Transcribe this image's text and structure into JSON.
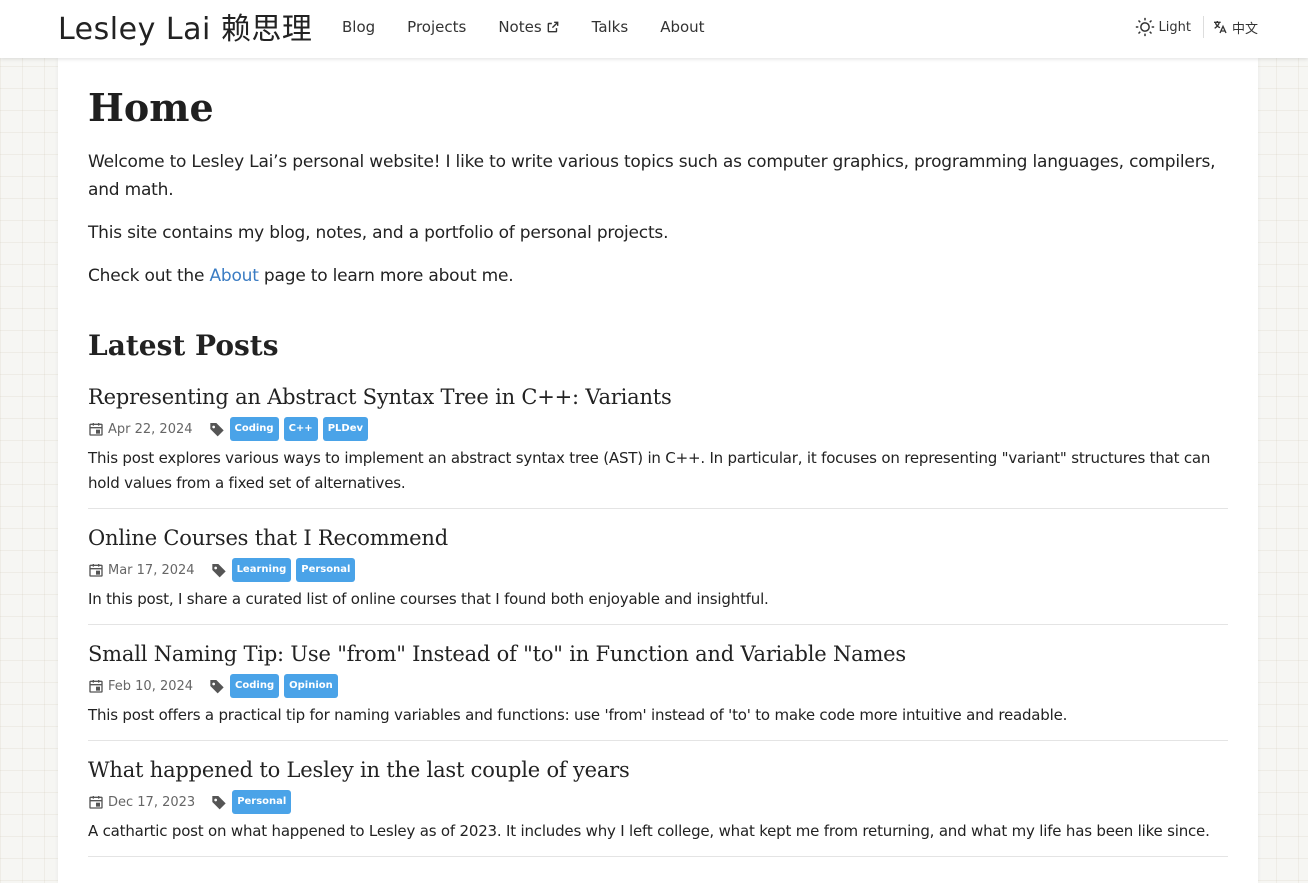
{
  "site": {
    "brand": "Lesley Lai 赖思理"
  },
  "nav": {
    "links": [
      {
        "label": "Blog"
      },
      {
        "label": "Projects"
      },
      {
        "label": "Notes",
        "icon": "external-link-icon"
      },
      {
        "label": "Talks"
      },
      {
        "label": "About"
      }
    ],
    "theme_label": "Light",
    "theme_icon": "sun-icon",
    "lang_label": "中文",
    "lang_icon": "translate-icon"
  },
  "home": {
    "title": "Home",
    "intro": {
      "p1": "Welcome to Lesley Lai’s personal website! I like to write various topics such as computer graphics, programming languages, compilers, and math.",
      "p2": "This site contains my blog, notes, and a portfolio of personal projects.",
      "p3_before": "Check out the ",
      "p3_link": "About",
      "p3_after": " page to learn more about me."
    },
    "latest_title": "Latest Posts",
    "posts": [
      {
        "title": "Representing an Abstract Syntax Tree in C++: Variants",
        "date": "Apr 22, 2024",
        "tags": [
          "Coding",
          "C++",
          "PLDev"
        ],
        "desc": "This post explores various ways to implement an abstract syntax tree (AST) in C++. In particular, it focuses on representing \"variant\" structures that can hold values from a fixed set of alternatives."
      },
      {
        "title": "Online Courses that I Recommend",
        "date": "Mar 17, 2024",
        "tags": [
          "Learning",
          "Personal"
        ],
        "desc": "In this post, I share a curated list of online courses that I found both enjoyable and insightful."
      },
      {
        "title": "Small Naming Tip: Use \"from\" Instead of \"to\" in Function and Variable Names",
        "date": "Feb 10, 2024",
        "tags": [
          "Coding",
          "Opinion"
        ],
        "desc": "This post offers a practical tip for naming variables and functions: use 'from' instead of 'to' to make code more intuitive and readable."
      },
      {
        "title": "What happened to Lesley in the last couple of years",
        "date": "Dec 17, 2023",
        "tags": [
          "Personal"
        ],
        "desc": "A cathartic post on what happened to Lesley as of 2023. It includes why I left college, what kept me from returning, and what my life has been like since."
      }
    ]
  },
  "colors": {
    "link": "#3a7cc3",
    "tag_bg": "#4aa3e8"
  }
}
